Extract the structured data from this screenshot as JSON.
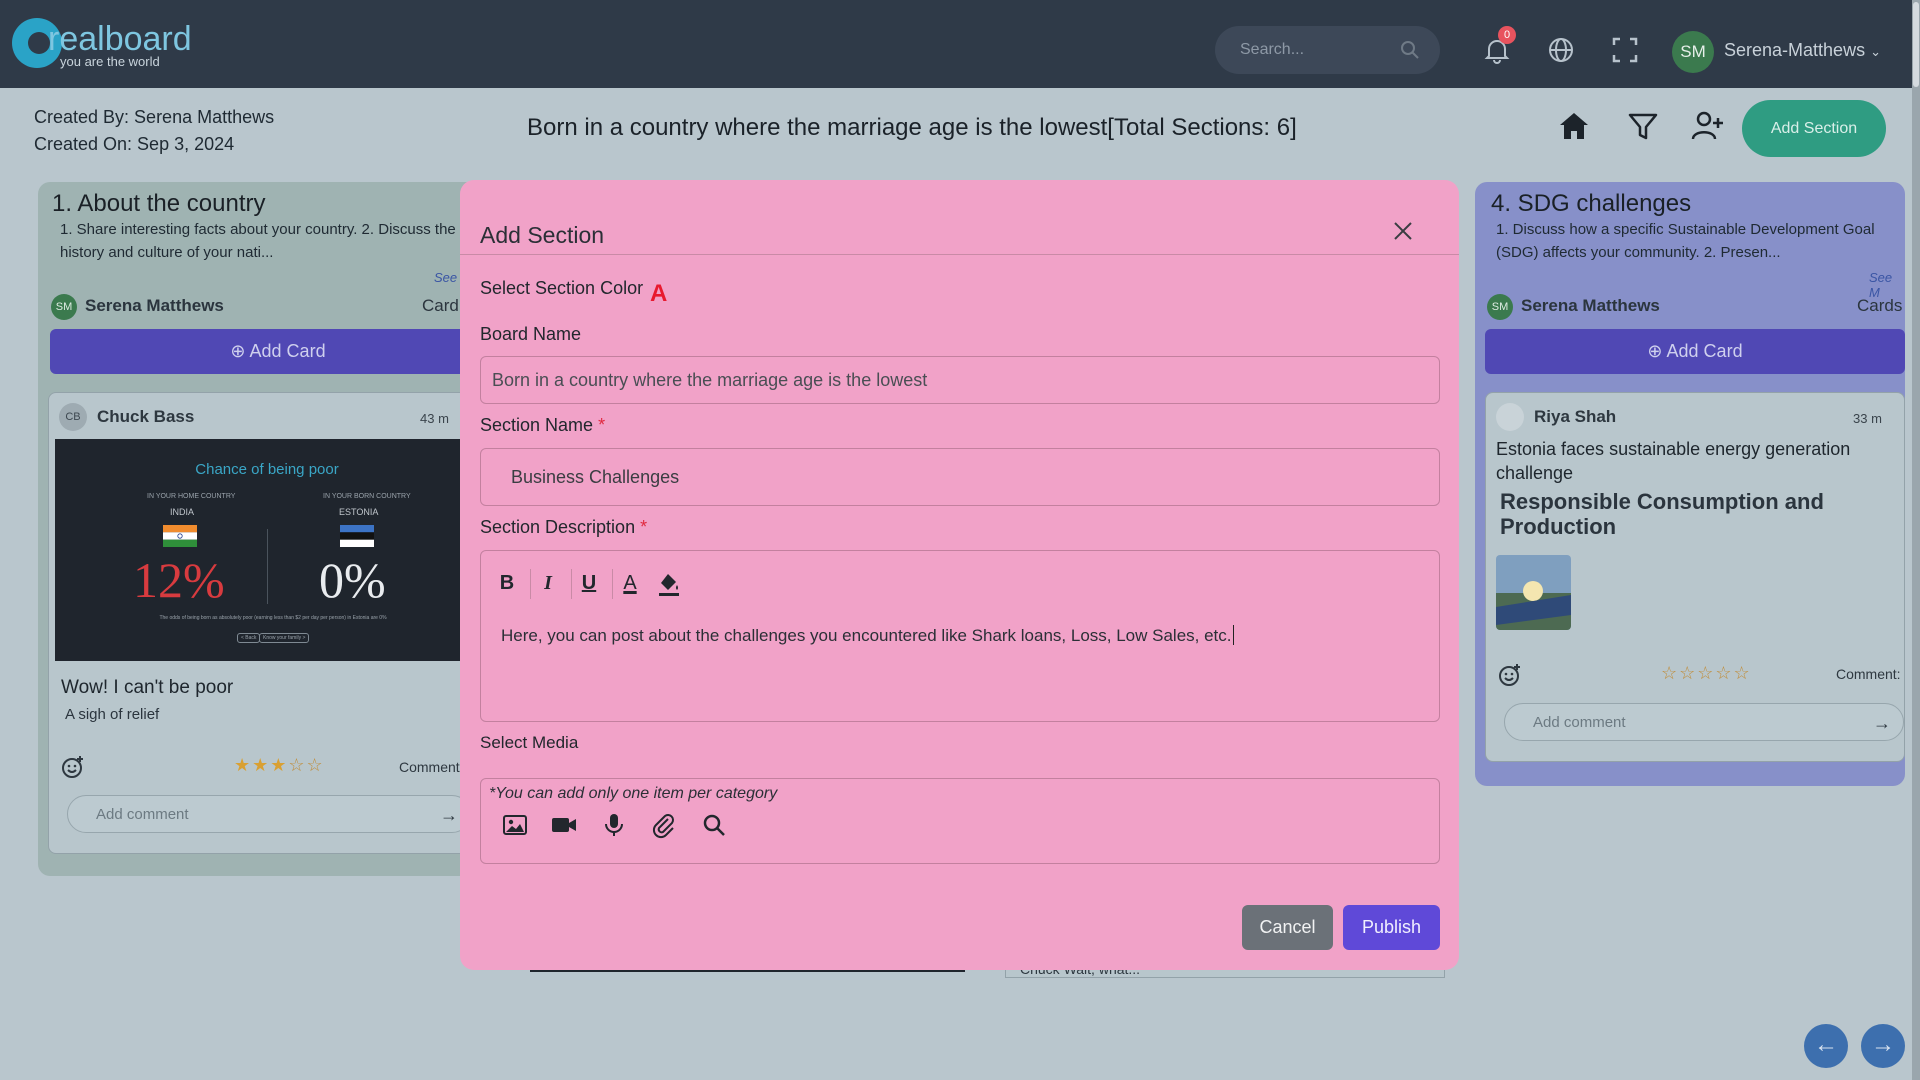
{
  "header": {
    "logo_name": "realboard",
    "logo_tagline": "you are the world",
    "search_placeholder": "Search...",
    "notification_count": "0",
    "avatar_initials": "SM",
    "username": "Serena-Matthews"
  },
  "board": {
    "created_by": "Created By: Serena Matthews",
    "created_on": "Created On: Sep 3, 2024",
    "title": "Born in a country where the marriage age is the lowest[Total Sections: 6]",
    "add_section_label": "Add Section"
  },
  "sections": [
    {
      "title": "1. About the country",
      "description": "1. Share interesting facts about your country. 2. Discuss the history and culture of your nati...",
      "see_more": "See",
      "owner_initials": "SM",
      "owner": "Serena Matthews",
      "cards_label": "Card",
      "add_card": "Add Card",
      "card": {
        "author_initials": "CB",
        "author": "Chuck Bass",
        "time": "43 m",
        "image": {
          "heading": "Chance of being poor",
          "left_caption": "IN YOUR HOME COUNTRY",
          "left_country": "INDIA",
          "left_value": "12%",
          "right_caption": "IN YOUR BORN COUNTRY",
          "right_country": "ESTONIA",
          "right_value": "0%",
          "footnote": "The odds of being born as absolutely poor (earning less than $2 per day per person) in Estonia are 0%",
          "btn1": "< Back",
          "btn2": "Know your family >"
        },
        "title": "Wow! I can't be poor",
        "subtitle": "A sigh of relief",
        "rating": 3,
        "comments_label": "Comment",
        "comment_placeholder": "Add comment"
      }
    },
    {
      "title": "4. SDG challenges",
      "description": "1. Discuss how a specific Sustainable Development Goal (SDG) affects your community. 2. Presen...",
      "see_more": "See M",
      "owner_initials": "SM",
      "owner": "Serena Matthews",
      "cards_label": "Cards",
      "add_card": "Add Card",
      "card": {
        "author": "Riya Shah",
        "time": "33 m",
        "title": "Estonia faces sustainable energy generation challenge",
        "tag": "Responsible Consumption and Production",
        "rating": 0,
        "comments_label": "Comment:",
        "comment_placeholder": "Add comment"
      }
    }
  ],
  "background_card_text": "Chuck Wait, what...",
  "modal": {
    "title": "Add Section",
    "color_label": "Select Section Color",
    "color_marker": "A",
    "board_name_label": "Board Name",
    "board_name_value": "Born in a country where the marriage age is the lowest",
    "section_name_label": "Section Name",
    "section_name_value": "Business Challenges",
    "section_desc_label": "Section Description",
    "required_mark": "*",
    "toolbar": {
      "bold": "B",
      "italic": "I",
      "underline": "U",
      "font_color": "A"
    },
    "description_value": "Here, you can post about the challenges you encountered like Shark loans, Loss, Low Sales, etc.",
    "media_label": "Select Media",
    "media_note": "*You can add only one item per category",
    "cancel": "Cancel",
    "publish": "Publish"
  },
  "colors": {
    "topbar": "#2f3a48",
    "modal_bg": "#f1a2c8",
    "accent_green": "#2f9c82",
    "publish": "#5f49d8",
    "cancel": "#6b7178",
    "add_card": "#5048b4"
  }
}
